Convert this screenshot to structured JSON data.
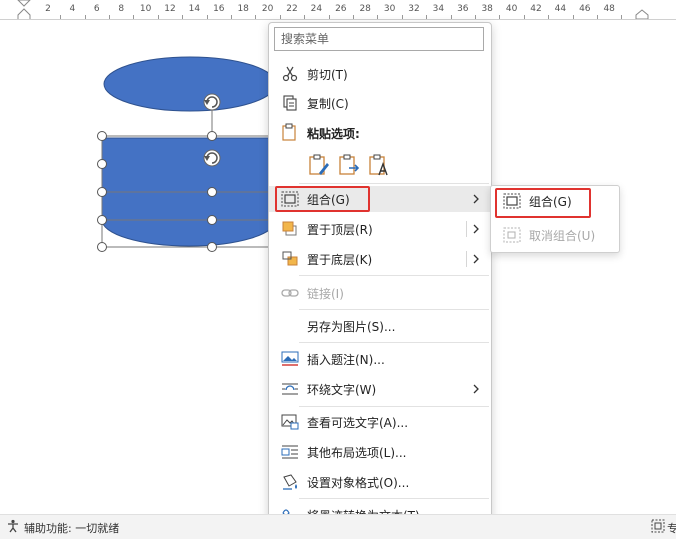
{
  "ruler": {
    "labels": [
      "2",
      "4",
      "6",
      "8",
      "10",
      "12",
      "14",
      "16",
      "18",
      "20",
      "22",
      "24",
      "26",
      "28",
      "30",
      "32",
      "34",
      "36",
      "38",
      "40",
      "42",
      "44",
      "46",
      "48"
    ]
  },
  "context_menu": {
    "search_placeholder": "搜索菜单",
    "items": {
      "cut": "剪切(T)",
      "copy": "复制(C)",
      "paste_options": "粘贴选项:",
      "group": "组合(G)",
      "bring_to_front": "置于顶层(R)",
      "send_to_back": "置于底层(K)",
      "link": "链接(I)",
      "save_as_picture": "另存为图片(S)...",
      "insert_caption": "插入题注(N)...",
      "wrap_text": "环绕文字(W)",
      "edit_alt_text": "查看可选文字(A)...",
      "more_layout": "其他布局选项(L)...",
      "format_object": "设置对象格式(O)...",
      "ink_to_text": "将墨迹转换为文本(T)"
    }
  },
  "submenu": {
    "group": "组合(G)",
    "ungroup": "取消组合(U)"
  },
  "status_bar": {
    "accessibility": "辅助功能: 一切就绪",
    "right_text": "专"
  },
  "colors": {
    "shape_fill": "#4472c4",
    "shape_stroke": "#2f528f",
    "highlight_border": "#e0332f",
    "icon_blue": "#2b6cb8",
    "icon_orange": "#c8823a"
  }
}
